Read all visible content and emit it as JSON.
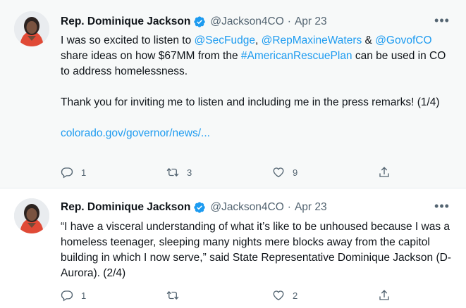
{
  "tweets": [
    {
      "author_name": "Rep. Dominique Jackson",
      "handle": "@Jackson4CO",
      "separator": "·",
      "date": "Apr 23",
      "more_glyph": "•••",
      "text": {
        "p1_a": "I was so excited to listen to ",
        "m1": "@SecFudge",
        "p1_b": ", ",
        "m2": "@RepMaxineWaters",
        "p1_c": " & ",
        "m3": "@GovofCO",
        "p1_d": " share ideas on how $67MM from the ",
        "hashtag": "#AmericanRescuePlan",
        "p1_e": " can be used in CO to address homelessness.",
        "p2": "Thank you for inviting me to listen and including me in the press remarks! (1/4)",
        "link": "colorado.gov/governor/news/..."
      },
      "reply_count": "1",
      "retweet_count": "3",
      "like_count": "9"
    },
    {
      "author_name": "Rep. Dominique Jackson",
      "handle": "@Jackson4CO",
      "separator": "·",
      "date": "Apr 23",
      "more_glyph": "•••",
      "text": {
        "p1": "“I have a visceral understanding of what it’s like to be unhoused because I was a homeless teenager, sleeping many nights mere blocks away from the capitol building in which I now serve,” said State Representative Dominique Jackson (D-Aurora). (2/4)"
      },
      "reply_count": "1",
      "retweet_count": "",
      "like_count": "2"
    }
  ],
  "colors": {
    "link": "#1d9bf0",
    "secondary_text": "#536471",
    "highlight_bg": "#f7f9f9",
    "verified": "#1d9bf0"
  },
  "icons": [
    "verified-badge-icon",
    "more-icon",
    "reply-icon",
    "retweet-icon",
    "like-icon",
    "share-icon"
  ]
}
